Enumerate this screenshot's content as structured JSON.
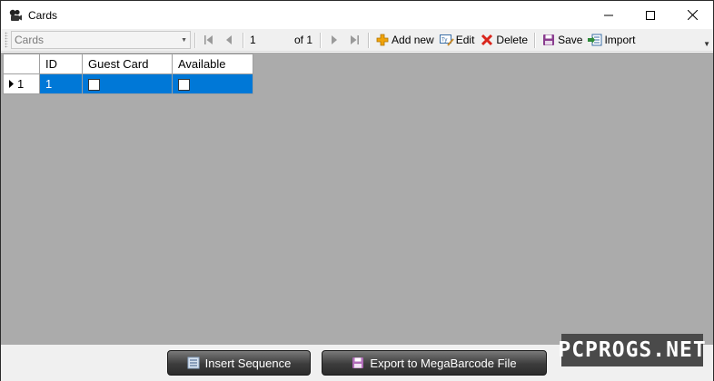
{
  "window": {
    "title": "Cards"
  },
  "icons": {
    "app": "film-reels-icon",
    "minimize": "minimize-icon",
    "maximize": "maximize-icon",
    "close": "close-icon",
    "first": "first-record-icon",
    "prev": "previous-record-icon",
    "next": "next-record-icon",
    "last": "last-record-icon",
    "add": "plus-icon",
    "edit": "edit-text-icon",
    "delete": "delete-x-icon",
    "save": "floppy-disk-icon",
    "import": "import-icon",
    "insert_sequence": "list-icon",
    "export": "floppy-disk-icon"
  },
  "toolbar": {
    "combo_value": "Cards",
    "position": "1",
    "of_label": "of 1",
    "add_label": "Add new",
    "edit_label": "Edit",
    "delete_label": "Delete",
    "save_label": "Save",
    "import_label": "Import"
  },
  "grid": {
    "columns": [
      "ID",
      "Guest Card",
      "Available"
    ],
    "rows": [
      {
        "row_header": "1",
        "id": "1",
        "guest_card": false,
        "available": false,
        "selected": true
      }
    ]
  },
  "footer": {
    "insert_sequence_label": "Insert Sequence",
    "export_label": "Export to MegaBarcode File"
  },
  "watermark": "PCPROGS.NET",
  "colors": {
    "selection": "#0078d7",
    "grid_background": "#ababab",
    "delete_red": "#d9261c",
    "add_orange": "#f0a30a",
    "save_purple": "#8a3d8f"
  }
}
